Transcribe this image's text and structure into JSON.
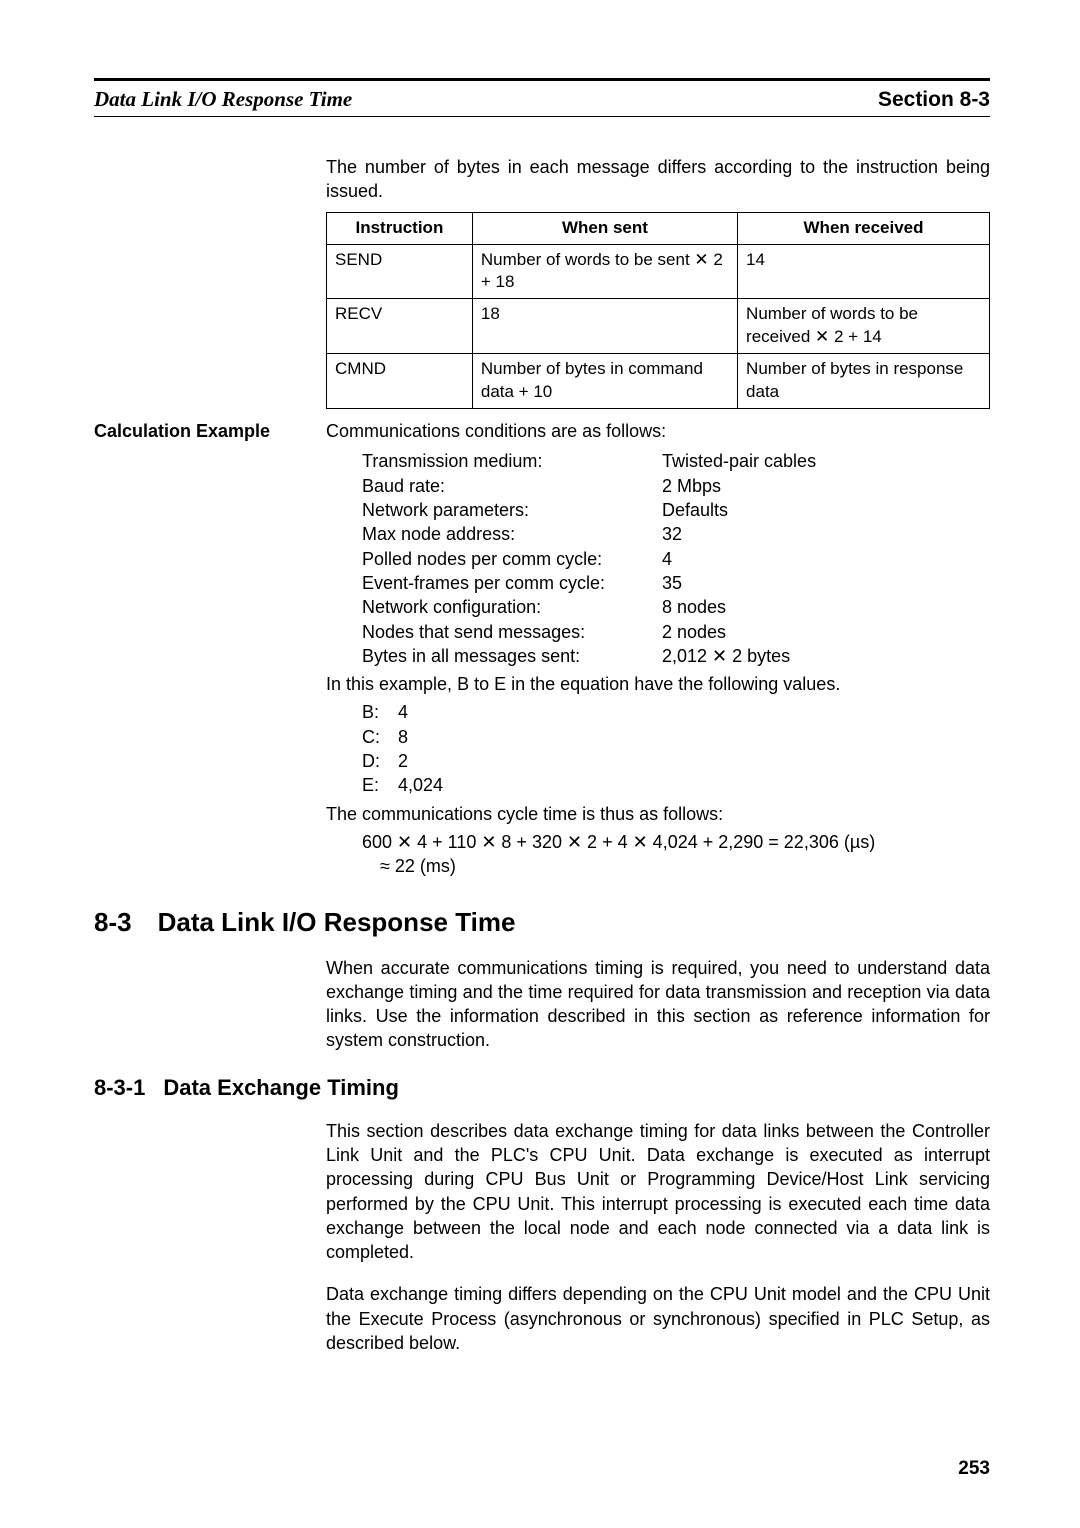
{
  "running_head": {
    "left": "Data Link I/O Response Time",
    "right": "Section 8-3"
  },
  "intro_paragraph": "The number of bytes in each message differs according to the instruction being issued.",
  "table": {
    "headers": [
      "Instruction",
      "When sent",
      "When received"
    ],
    "rows": [
      [
        "SEND",
        "Number of words to be sent ✕ 2 + 18",
        "14"
      ],
      [
        "RECV",
        "18",
        "Number of words to be received ✕ 2 + 14"
      ],
      [
        "CMND",
        "Number of bytes in command data + 10",
        "Number of bytes in response data"
      ]
    ]
  },
  "side_label": "Calculation Example",
  "side_intro": "Communications conditions are as follows:",
  "conditions": [
    {
      "k": "Transmission medium:",
      "v": "Twisted-pair cables"
    },
    {
      "k": "Baud rate:",
      "v": "2 Mbps"
    },
    {
      "k": "Network parameters:",
      "v": "Defaults"
    },
    {
      "k": "Max node address:",
      "v": "32"
    },
    {
      "k": "Polled nodes per comm cycle:",
      "v": "4"
    },
    {
      "k": "Event-frames per comm cycle:",
      "v": "35"
    },
    {
      "k": "Network configuration:",
      "v": "8 nodes"
    },
    {
      "k": "Nodes that send messages:",
      "v": "2 nodes"
    },
    {
      "k": "Bytes in all messages sent:",
      "v": "2,012 ✕ 2 bytes"
    }
  ],
  "values_note": "In this example, B to E in the equation have the following values.",
  "values": [
    {
      "k": "B:",
      "v": "4"
    },
    {
      "k": "C:",
      "v": "8"
    },
    {
      "k": "D:",
      "v": "2"
    },
    {
      "k": "E:",
      "v": "4,024"
    }
  ],
  "cycle_intro": "The communications cycle time is thus as follows:",
  "equation_line": "600 ✕ 4 + 110 ✕ 8 + 320 ✕ 2 + 4 ✕ 4,024 + 2,290 = 22,306 (µs)",
  "equation_sub": "≈ 22 (ms)",
  "section": {
    "num": "8-3",
    "title": "Data Link I/O Response Time",
    "para": "When accurate communications timing is required, you need to understand data exchange timing and the time required for data transmission and reception via data links. Use the information described in this section as reference information for system construction."
  },
  "subsection": {
    "num": "8-3-1",
    "title": "Data Exchange Timing",
    "para1": "This section describes data exchange timing for data links between the Controller Link Unit and the PLC's CPU Unit. Data exchange is executed as interrupt processing during CPU Bus Unit or Programming Device/Host Link servicing performed by the CPU Unit. This interrupt processing is executed each time data exchange between the local node and each node connected via a data link is completed.",
    "para2": "Data exchange timing differs depending on the CPU Unit model and the CPU Unit the Execute Process (asynchronous or synchronous) specified in PLC Setup, as described below."
  },
  "page_number": "253"
}
